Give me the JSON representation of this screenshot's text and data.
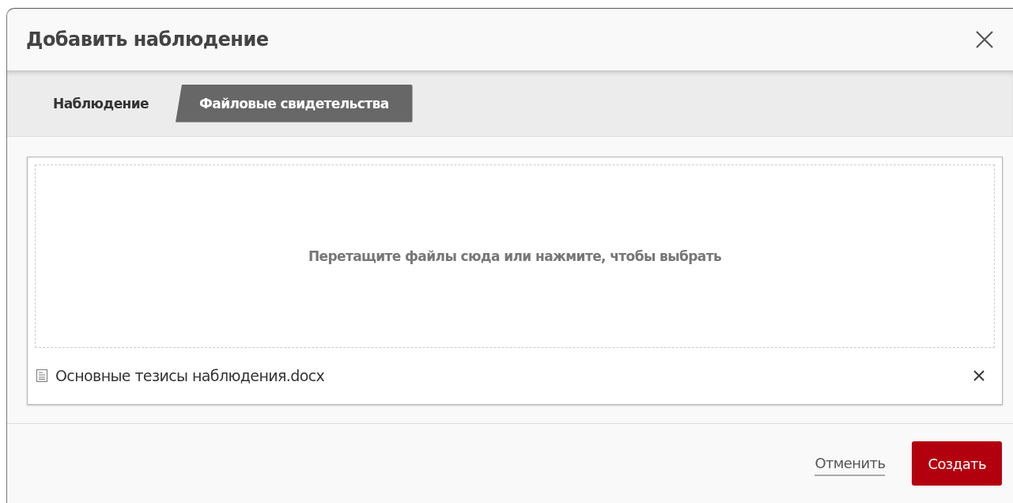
{
  "dialog": {
    "title": "Добавить наблюдение"
  },
  "tabs": [
    {
      "label": "Наблюдение",
      "selected": false
    },
    {
      "label": "Файловые свидетельства",
      "selected": true
    }
  ],
  "dropzone": {
    "text": "Перетащите файлы сюда или нажмите, чтобы выбрать"
  },
  "files": [
    {
      "name": "Основные тезисы наблюдения.docx"
    }
  ],
  "buttons": [
    {
      "label": "Отменить",
      "kind": "link"
    },
    {
      "label": "Создать",
      "kind": "primary"
    }
  ]
}
